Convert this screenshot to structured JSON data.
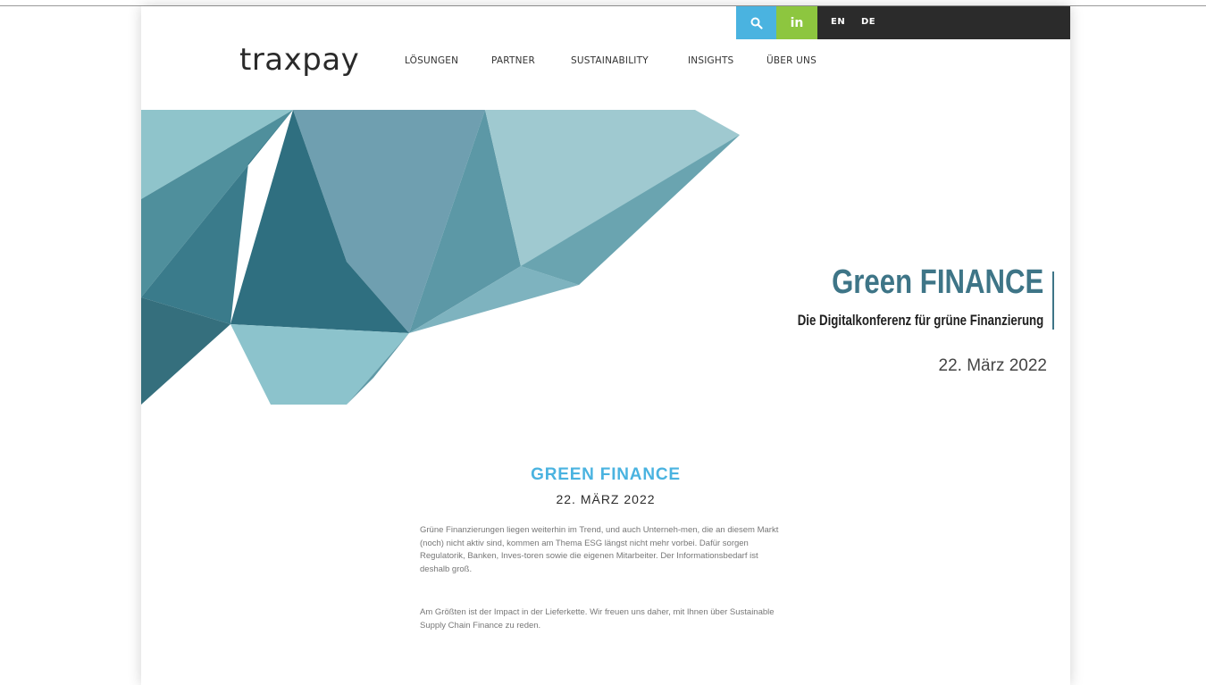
{
  "topbar": {
    "lang_en": "EN",
    "lang_de": "DE",
    "linkedin_label": "in",
    "search_icon": "search-icon",
    "search_color": "#4ab3e0",
    "linkedin_color": "#8dc63f"
  },
  "header": {
    "logo": "traxpay",
    "nav": [
      "LÖSUNGEN",
      "PARTNER",
      "SUSTAINABILITY",
      "INSIGHTS",
      "ÜBER UNS"
    ]
  },
  "hero": {
    "title": "Green FINANCE",
    "subtitle": "Die Digitalkonferenz für grüne Finanzierung",
    "date": "22. März 2022",
    "accent": "#3e7587"
  },
  "section": {
    "title": "GREEN FINANCE",
    "date": "22. MÄRZ 2022",
    "paragraphs": [
      "Grüne Finanzierungen liegen weiterhin im Trend, und auch Unterneh-men, die an diesem Markt (noch) nicht aktiv sind, kommen am Thema ESG längst nicht mehr vorbei. Dafür sorgen Regulatorik, Banken, Inves-toren sowie die eigenen Mitarbeiter. Der Informationsbedarf ist deshalb groß.",
      "Am Größten ist der Impact in der Lieferkette. Wir freuen uns daher, mit Ihnen über Sustainable Supply Chain Finance zu reden."
    ]
  }
}
